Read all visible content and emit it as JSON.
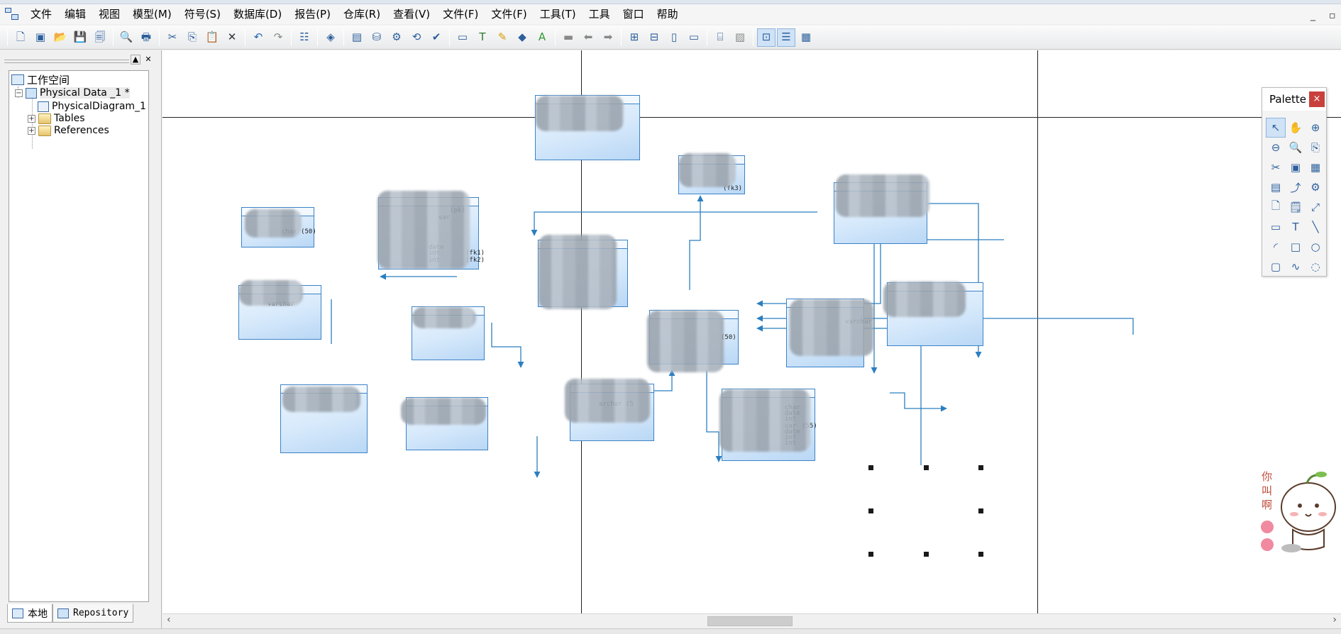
{
  "menu": [
    "文件",
    "编辑",
    "视图",
    "模型(M)",
    "符号(S)",
    "数据库(D)",
    "报告(P)",
    "仓库(R)",
    "查看(V)",
    "文件(F)",
    "文件(F)",
    "工具(T)",
    "工具",
    "窗口",
    "帮助"
  ],
  "window_controls": {
    "minimize": "_",
    "restore": "▫"
  },
  "toolbar": {
    "groups": [
      [
        "new-icon",
        "open-model-icon",
        "open-folder-icon",
        "save-icon",
        "save-all-icon"
      ],
      [
        "print-preview-icon",
        "print-icon"
      ],
      [
        "cut-icon",
        "copy-icon",
        "paste-icon",
        "delete-icon"
      ],
      [
        "undo-icon",
        "redo-icon"
      ],
      [
        "properties-icon"
      ],
      [
        "model-check-icon"
      ],
      [
        "package-icon",
        "database-icon",
        "generate-icon",
        "reverse-icon",
        "check-icon"
      ],
      [
        "window-icon",
        "text-icon",
        "pencil-icon",
        "fill-icon",
        "font-icon"
      ],
      [
        "folder-grey-icon",
        "arrow-left-icon",
        "arrow-right-icon"
      ],
      [
        "symbol-1-icon",
        "symbol-2-icon",
        "symbol-3-icon",
        "symbol-4-icon"
      ],
      [
        "image-icon",
        "image-grey-icon"
      ],
      [
        "browser-icon",
        "output-icon",
        "result-icon"
      ]
    ],
    "glyphs": {
      "new-icon": "🗋",
      "open-model-icon": "▣",
      "open-folder-icon": "📂",
      "save-icon": "💾",
      "save-all-icon": "🗐",
      "print-preview-icon": "🔍",
      "print-icon": "🖶",
      "cut-icon": "✂",
      "copy-icon": "⎘",
      "paste-icon": "📋",
      "delete-icon": "✕",
      "undo-icon": "↶",
      "redo-icon": "↷",
      "properties-icon": "☷",
      "model-check-icon": "◈",
      "package-icon": "▤",
      "database-icon": "⛁",
      "generate-icon": "⚙",
      "reverse-icon": "⟲",
      "check-icon": "✔",
      "window-icon": "▭",
      "text-icon": "T",
      "pencil-icon": "✎",
      "fill-icon": "◆",
      "font-icon": "A",
      "folder-grey-icon": "▬",
      "arrow-left-icon": "⬅",
      "arrow-right-icon": "➡",
      "symbol-1-icon": "⊞",
      "symbol-2-icon": "⊟",
      "symbol-3-icon": "▯",
      "symbol-4-icon": "▭",
      "image-icon": "⌸",
      "image-grey-icon": "▨",
      "browser-icon": "⊡",
      "output-icon": "☰",
      "result-icon": "▦"
    }
  },
  "browser": {
    "root": "工作空间",
    "model": "Physical Data _1 *",
    "diagram": "PhysicalDiagram_1",
    "tables": "Tables",
    "references": "References",
    "tabs": [
      "本地",
      "Repository"
    ],
    "header_controls": [
      "▲",
      "✕"
    ]
  },
  "tables": [
    {
      "id": "t1",
      "cells": [
        "char (50)"
      ]
    },
    {
      "id": "t2",
      "cells": [
        "varchar"
      ]
    },
    {
      "id": "t3",
      "cells": [
        "(pk)",
        "var",
        "date",
        "int",
        "int",
        "(fk1)",
        "(fk2)"
      ]
    },
    {
      "id": "t4",
      "cells": []
    },
    {
      "id": "t5",
      "cells": []
    },
    {
      "id": "t6",
      "cells": []
    },
    {
      "id": "t7",
      "cells": []
    },
    {
      "id": "t8",
      "cells": [
        "(fk3)"
      ]
    },
    {
      "id": "t9",
      "cells": []
    },
    {
      "id": "t10",
      "cells": [
        "(50)"
      ]
    },
    {
      "id": "t11",
      "cells": [
        "varchar"
      ]
    },
    {
      "id": "t12",
      "cells": []
    },
    {
      "id": "t13",
      "cells": []
    },
    {
      "id": "t14",
      "cells": [
        "archar (5"
      ]
    },
    {
      "id": "t15",
      "cells": [
        "char",
        "date",
        "int",
        "var",
        "date",
        "int",
        "int",
        "(55)"
      ]
    }
  ],
  "palette": {
    "title": "Palette",
    "close": "×",
    "tools": [
      "pointer-icon",
      "hand-icon",
      "zoom-in-icon",
      "zoom-out-icon",
      "zoom-icon",
      "open-package-icon",
      "cut-icon",
      "package-icon",
      "table-icon",
      "view-icon",
      "reference-icon",
      "procedure-icon",
      "file-icon",
      "note-icon",
      "link-icon",
      "rounded-rect-icon",
      "text-tool-icon",
      "line-icon",
      "arc-icon",
      "rectangle-icon",
      "ellipse-icon",
      "rounded-icon",
      "polyline-icon",
      "polygon-icon"
    ],
    "glyphs": {
      "pointer-icon": "↖",
      "hand-icon": "✋",
      "zoom-in-icon": "⊕",
      "zoom-out-icon": "⊖",
      "zoom-icon": "🔍",
      "open-package-icon": "⎘",
      "cut-icon": "✂",
      "package-icon": "▣",
      "table-icon": "▦",
      "view-icon": "▤",
      "reference-icon": "⤴",
      "procedure-icon": "⚙",
      "file-icon": "🗋",
      "note-icon": "🗒",
      "link-icon": "⤢",
      "rounded-rect-icon": "▭",
      "text-tool-icon": "T",
      "line-icon": "╲",
      "arc-icon": "◜",
      "rectangle-icon": "□",
      "ellipse-icon": "○",
      "rounded-icon": "▢",
      "polyline-icon": "∿",
      "polygon-icon": "◌"
    }
  },
  "sticker": {
    "text": "你叫啊"
  },
  "colors": {
    "link": "#2b7fc0",
    "table_border": "#3b83c7",
    "palette_close": "#c8403c"
  }
}
